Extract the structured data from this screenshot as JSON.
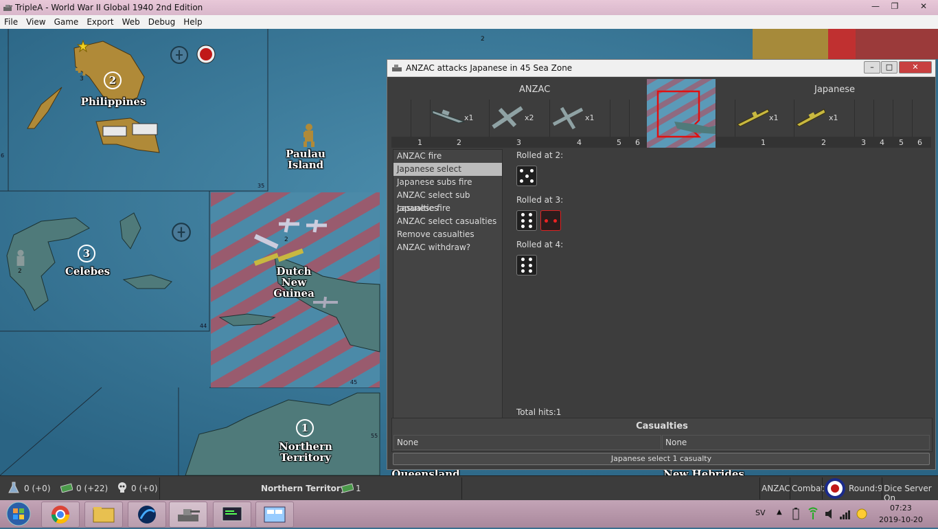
{
  "window": {
    "title": "TripleA - World War II Global 1940 2nd Edition",
    "controls": [
      "minimize",
      "restore",
      "close"
    ]
  },
  "menu": {
    "items": [
      "File",
      "View",
      "Game",
      "Export",
      "Web",
      "Debug",
      "Help"
    ],
    "mnemonics": [
      "F",
      "V",
      "G",
      "E",
      "W",
      "D",
      "H"
    ]
  },
  "map": {
    "territories": [
      {
        "name": "Philippines",
        "value": "2"
      },
      {
        "name": "Paulau Island"
      },
      {
        "name": "Celebes",
        "value": "3"
      },
      {
        "name": "Dutch New Guinea"
      },
      {
        "name": "Northern Territory",
        "value": "1"
      },
      {
        "name": "Queensland"
      },
      {
        "name": "New Hebrides"
      }
    ],
    "sea_zones": [
      "35",
      "44",
      "45",
      "55",
      "6"
    ],
    "unit_counts": [
      "3",
      "2",
      "2",
      "2"
    ],
    "colors": {
      "sea": "#2f6c8e",
      "land": "#b08a38",
      "contested": "#b24a5a"
    }
  },
  "battle": {
    "title": "ANZAC attacks Japanese in 45 Sea Zone",
    "attacker": "ANZAC",
    "defender": "Japanese",
    "attacker_units": [
      {
        "type": "cruiser-icon",
        "count": "x1",
        "column": "2"
      },
      {
        "type": "fighter-icon",
        "count": "x2",
        "column": "3"
      },
      {
        "type": "tactical-bomber-icon",
        "count": "x1",
        "column": "4"
      }
    ],
    "defender_units": [
      {
        "type": "submarine-icon",
        "count": "x1",
        "column": "1"
      },
      {
        "type": "destroyer-icon",
        "count": "x1",
        "column": "2"
      }
    ],
    "attacker_columns": [
      "1",
      "2",
      "3",
      "4",
      "5",
      "6"
    ],
    "defender_columns": [
      "1",
      "2",
      "3",
      "4",
      "5",
      "6"
    ],
    "steps": [
      {
        "label": "ANZAC fire",
        "selected": false
      },
      {
        "label": "Japanese select casualties",
        "selected": true
      },
      {
        "label": "Japanese subs fire",
        "selected": false
      },
      {
        "label": "ANZAC select sub casualties",
        "selected": false
      },
      {
        "label": "Japanese fire",
        "selected": false
      },
      {
        "label": "ANZAC select casualties",
        "selected": false
      },
      {
        "label": "Remove casualties",
        "selected": false
      },
      {
        "label": "ANZAC withdraw?",
        "selected": false
      }
    ],
    "rolls": [
      {
        "label": "Rolled at 2:",
        "dice": [
          {
            "value": 5,
            "hit": false
          }
        ]
      },
      {
        "label": "Rolled at 3:",
        "dice": [
          {
            "value": 6,
            "hit": false
          },
          {
            "value": 2,
            "hit": true
          }
        ]
      },
      {
        "label": "Rolled at 4:",
        "dice": [
          {
            "value": 6,
            "hit": false
          }
        ]
      }
    ],
    "total_hits": "Total hits:1",
    "casualties_header": "Casualties",
    "casualties_left": "None",
    "casualties_right": "None",
    "status_button": "Japanese select 1 casualty"
  },
  "statusbar": {
    "research": "0 (+0)",
    "pus": "0 (+22)",
    "techtokens": "0 (+0)",
    "territory": "Northern Territory",
    "territory_pus": "1",
    "player": "ANZAC",
    "phase": "Combat",
    "round": "Round:9",
    "dice": "Dice Server On"
  },
  "taskbar": {
    "apps": [
      "start-orb",
      "chrome-icon",
      "explorer-icon",
      "media-icon",
      "triplea-icon",
      "terminal-icon",
      "control-panel-icon"
    ],
    "lang": "SV",
    "time": "07:23",
    "date": "2019-10-20"
  }
}
